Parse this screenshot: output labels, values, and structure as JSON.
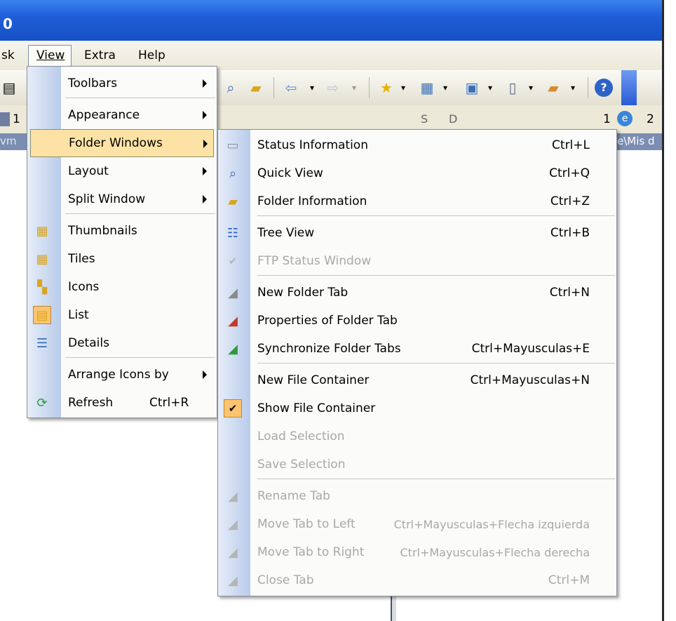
{
  "window": {
    "title": "0"
  },
  "menubar": {
    "items": [
      "sk",
      "View",
      "Extra",
      "Help"
    ]
  },
  "tabs": {
    "visible": [
      "1",
      "S",
      "D",
      "1",
      "2"
    ]
  },
  "address": {
    "left_fragment": "vm",
    "right_fragment": "e\\Mis d"
  },
  "view_menu": {
    "items": [
      {
        "label": "Toolbars",
        "submenu": true
      },
      {
        "label": "Appearance",
        "submenu": true
      },
      {
        "label": "Folder Windows",
        "submenu": true,
        "highlighted": true
      },
      {
        "label": "Layout",
        "submenu": true
      },
      {
        "label": "Split Window",
        "submenu": true
      },
      {
        "label": "Thumbnails",
        "icon": "thumbnails-icon"
      },
      {
        "label": "Tiles",
        "icon": "tiles-icon"
      },
      {
        "label": "Icons",
        "icon": "icons-view-icon"
      },
      {
        "label": "List",
        "icon": "list-view-icon",
        "checked": true
      },
      {
        "label": "Details",
        "icon": "details-view-icon"
      },
      {
        "label": "Arrange Icons by",
        "submenu": true
      },
      {
        "label": "Refresh",
        "shortcut": "Ctrl+R",
        "icon": "refresh-icon"
      }
    ]
  },
  "folder_windows_menu": {
    "items": [
      {
        "label": "Status Information",
        "shortcut": "Ctrl+L",
        "icon": "status-bar-icon"
      },
      {
        "label": "Quick View",
        "shortcut": "Ctrl+Q",
        "icon": "quick-view-icon"
      },
      {
        "label": "Folder Information",
        "shortcut": "Ctrl+Z",
        "icon": "folder-icon"
      },
      {
        "label": "Tree View",
        "shortcut": "Ctrl+B",
        "icon": "tree-view-icon"
      },
      {
        "label": "FTP Status Window",
        "shortcut": "",
        "icon": "checkmark-icon",
        "disabled": true
      },
      {
        "label": "New Folder Tab",
        "shortcut": "Ctrl+N",
        "icon": "new-tab-icon"
      },
      {
        "label": "Properties of Folder Tab",
        "shortcut": "",
        "icon": "tab-properties-icon"
      },
      {
        "label": "Synchronize Folder Tabs",
        "shortcut": "Ctrl+Mayusculas+E",
        "icon": "sync-tabs-icon"
      },
      {
        "label": "New File Container",
        "shortcut": "Ctrl+Mayusculas+N",
        "icon": ""
      },
      {
        "label": "Show File Container",
        "shortcut": "",
        "icon": "checkmark-icon",
        "checked": true
      },
      {
        "label": "Load Selection",
        "shortcut": "",
        "icon": "",
        "disabled": true
      },
      {
        "label": "Save Selection",
        "shortcut": "",
        "icon": "",
        "disabled": true
      },
      {
        "label": "Rename Tab",
        "shortcut": "",
        "icon": "rename-tab-icon",
        "disabled": true
      },
      {
        "label": "Move Tab to Left",
        "shortcut": "Ctrl+Mayusculas+Flecha izquierda",
        "icon": "move-tab-left-icon",
        "disabled": true
      },
      {
        "label": "Move Tab to Right",
        "shortcut": "Ctrl+Mayusculas+Flecha derecha",
        "icon": "move-tab-right-icon",
        "disabled": true
      },
      {
        "label": "Close Tab",
        "shortcut": "Ctrl+M",
        "icon": "close-tab-icon",
        "disabled": true
      }
    ]
  }
}
